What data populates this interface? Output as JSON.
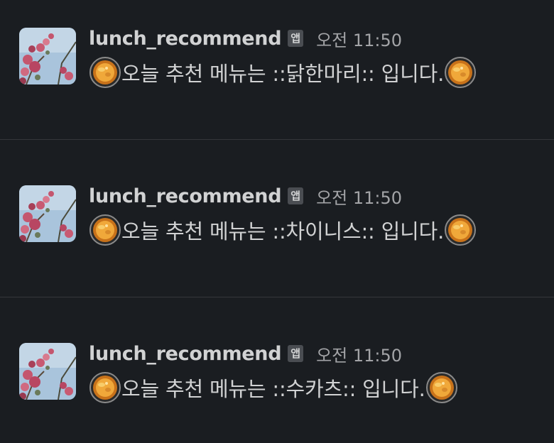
{
  "messages": [
    {
      "sender": "lunch_recommend",
      "badge": "앱",
      "time": "오전 11:50",
      "text": "오늘 추천 메뉴는 ::닭한마리:: 입니다.",
      "emoji_icon": "hotpot-emoji-icon"
    },
    {
      "sender": "lunch_recommend",
      "badge": "앱",
      "time": "오전 11:50",
      "text": "오늘 추천 메뉴는 ::차이니스:: 입니다.",
      "emoji_icon": "hotpot-emoji-icon"
    },
    {
      "sender": "lunch_recommend",
      "badge": "앱",
      "time": "오전 11:50",
      "text": "오늘 추천 메뉴는 ::수카츠:: 입니다.",
      "emoji_icon": "hotpot-emoji-icon"
    }
  ],
  "colors": {
    "background": "#1a1d21",
    "text": "#d1d2d3",
    "muted": "#a3a4a7",
    "divider": "#35373b",
    "badge_bg": "#4a4d52"
  }
}
